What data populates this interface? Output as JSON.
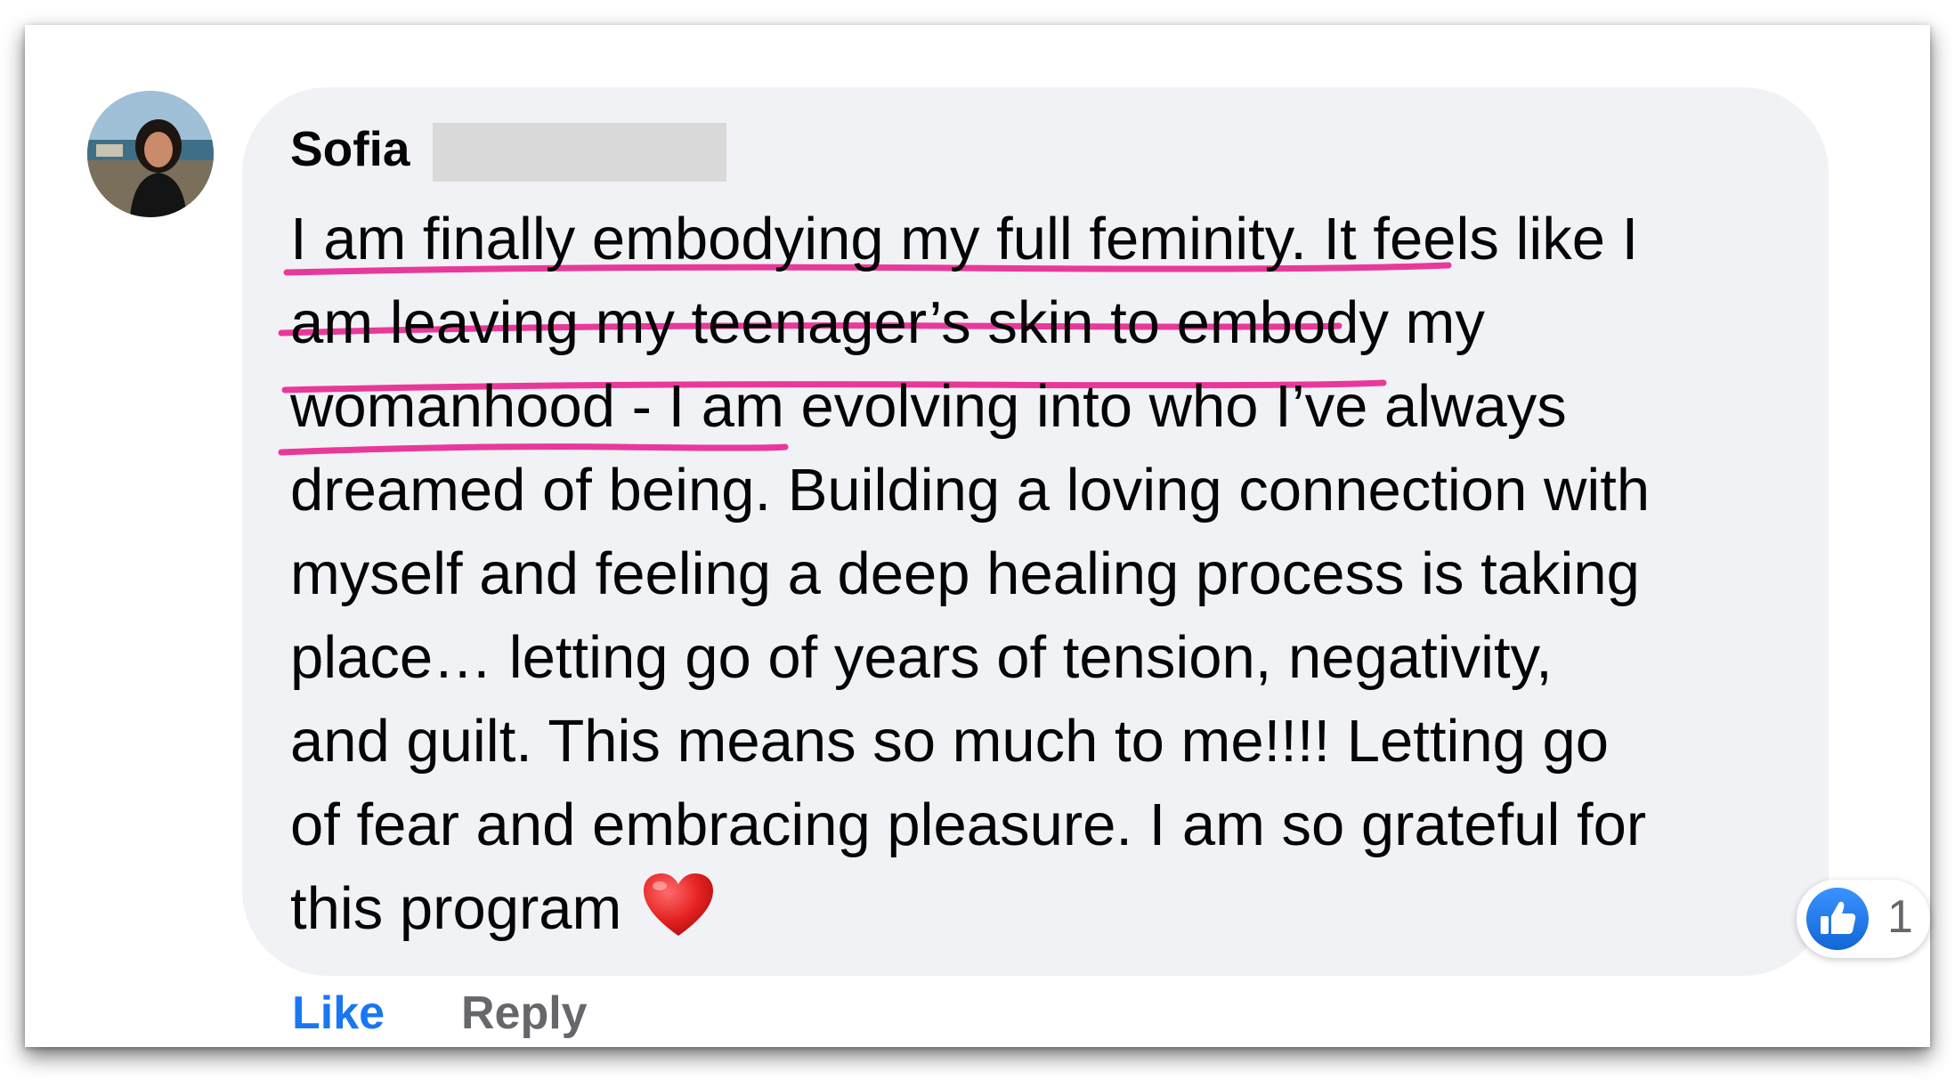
{
  "comment": {
    "author": "Sofia",
    "author_surname_redacted": true,
    "lines": [
      "I am finally embodying my full feminity. It feels like I",
      "am leaving my teenager’s skin to embody my",
      "womanhood - I am evolving into who I’ve always",
      "dreamed of being. Building a loving connection with",
      "myself and feeling a deep healing process is taking",
      "place… letting go of years of tension, negativity,",
      "and guilt. This means so much to me!!!! Letting go",
      "of fear and embracing pleasure. I am so grateful for",
      "this program"
    ],
    "emoji": "heart-emoji",
    "highlight_color": "#e8399a",
    "highlighted_line_count": 4
  },
  "reactions": {
    "icon": "thumbs-up-icon",
    "count": "1",
    "color": "#1877f2"
  },
  "actions": {
    "like_label": "Like",
    "reply_label": "Reply"
  }
}
